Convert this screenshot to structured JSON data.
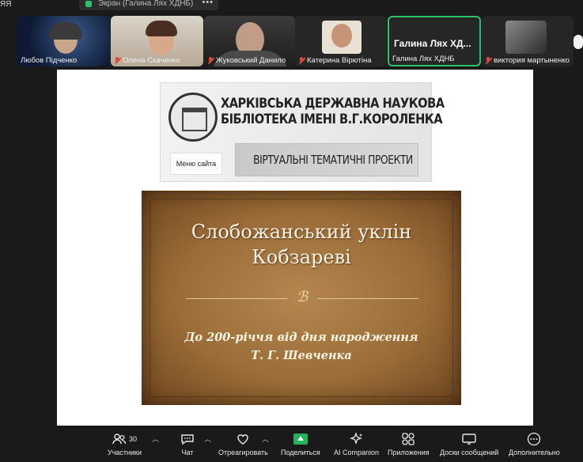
{
  "top": {
    "left_text": "ЯЯ",
    "sharing_label": "Экран (Галина Лях ХДНБ)"
  },
  "participants": [
    {
      "name": "Любов Підченко",
      "muted": false
    },
    {
      "name": "Олена Скаченко",
      "muted": true
    },
    {
      "name": "Жуковський Данило",
      "muted": true
    },
    {
      "name": "Катерина Вірютіна",
      "muted": true
    },
    {
      "name": "Галина Лях ХДНБ",
      "display": "Галина Лях ХД...",
      "muted": false,
      "active_speaker": true
    },
    {
      "name": "виктория мартыненко",
      "muted": true
    }
  ],
  "content": {
    "banner_title_line1": "ХАРКІВСЬКА ДЕРЖАВНА НАУКОВА",
    "banner_title_line2": "БІБЛІОТЕКА ІМЕНІ В.Г.КОРОЛЕНКА",
    "menu_button": "Меню сайта",
    "projects_label": "ВІРТУАЛЬНІ ТЕМАТИЧНІ ПРОЕКТИ",
    "slide_title_line1": "Слобожанський уклін",
    "slide_title_line2": "Кобзареві",
    "slide_ornament": "ℬ",
    "slide_sub_line1": "До 200-річчя від дня народження",
    "slide_sub_line2": "Т. Г. Шевченка"
  },
  "toolbar": {
    "participants": "Участники",
    "participants_count": "30",
    "chat": "Чат",
    "react": "Отреагировать",
    "share": "Поделиться",
    "ai": "AI Companion",
    "apps": "Приложения",
    "whiteboards": "Доски сообщений",
    "more": "Дополнительно"
  },
  "colors": {
    "active_speaker": "#29c46a",
    "share_green": "#23b35c",
    "muted_red": "#e0483c"
  }
}
